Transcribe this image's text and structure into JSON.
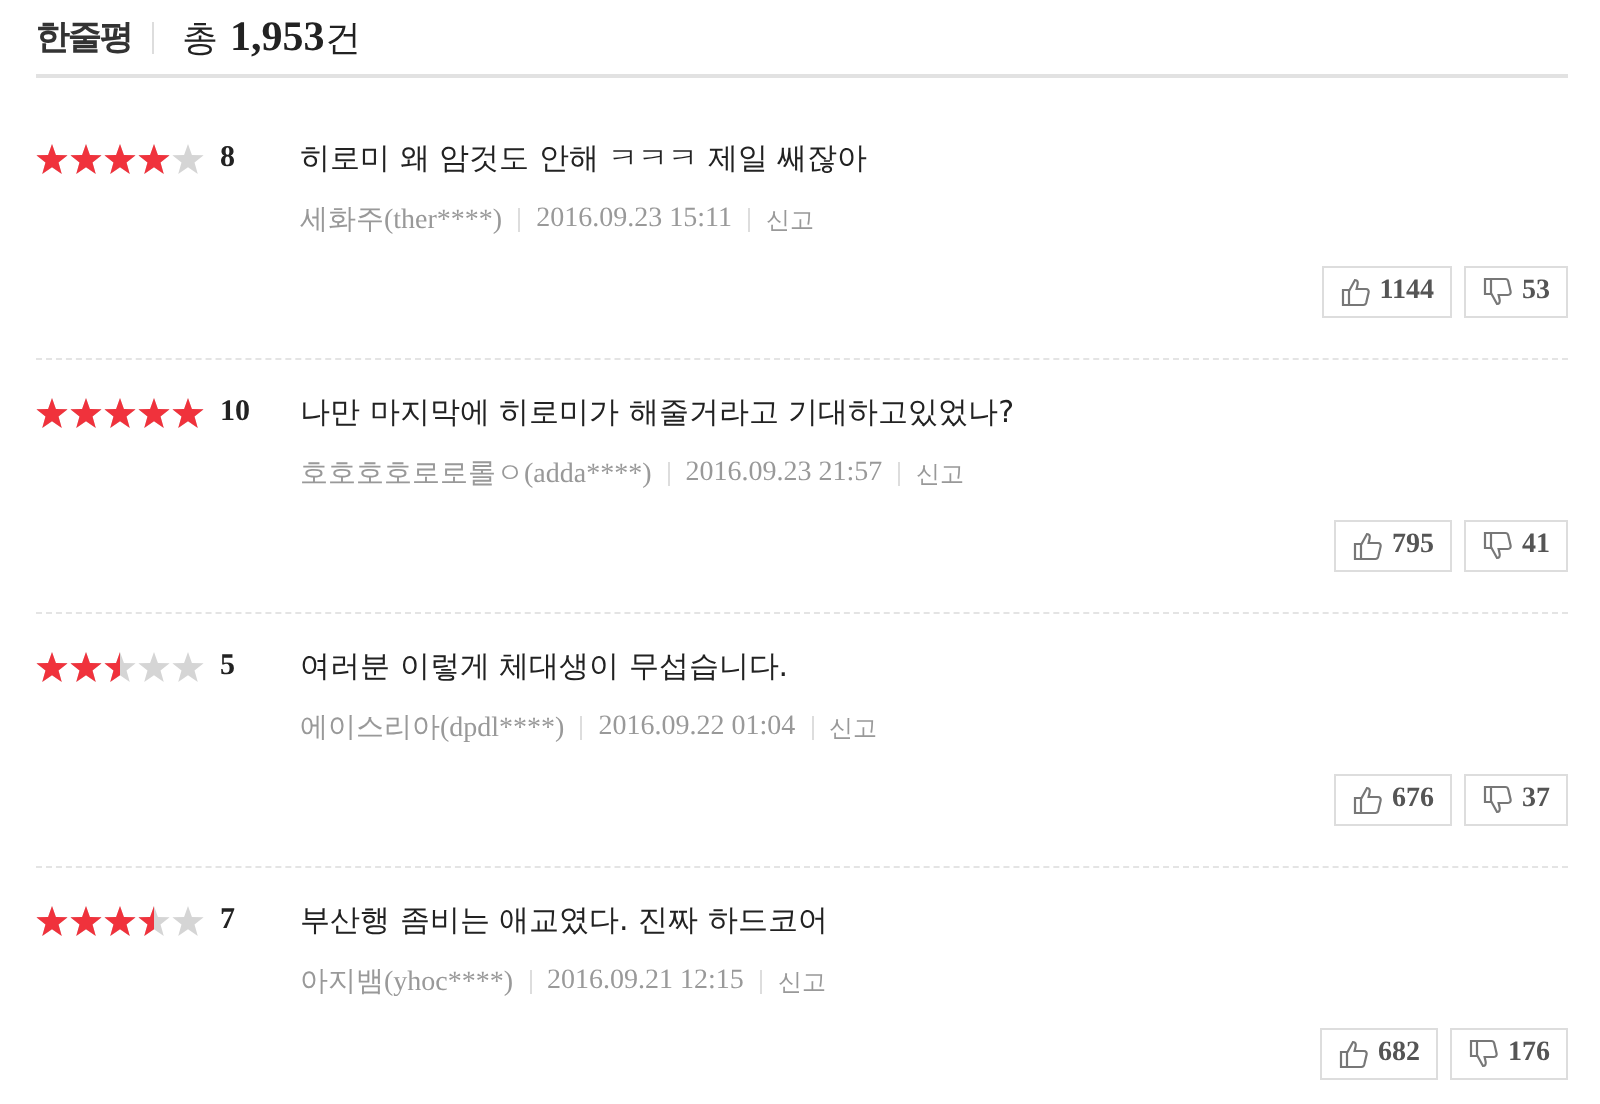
{
  "header": {
    "title": "한줄평",
    "total_prefix": "총",
    "total_count": "1,953",
    "total_suffix": "건"
  },
  "reviews": [
    {
      "stars": 4,
      "score": "8",
      "text": "히로미 왜 암것도 안해 ㅋㅋㅋ 제일 쌔잖아",
      "author": "세화주(ther****)",
      "date": "2016.09.23 15:11",
      "report": "신고",
      "likes": "1144",
      "dislikes": "53"
    },
    {
      "stars": 5,
      "score": "10",
      "text": "나만 마지막에 히로미가 해줄거라고 기대하고있었나?",
      "author": "호호호호로로롤ㅇ(adda****)",
      "date": "2016.09.23 21:57",
      "report": "신고",
      "likes": "795",
      "dislikes": "41"
    },
    {
      "stars": 2.5,
      "score": "5",
      "text": "여러분 이렇게 체대생이 무섭습니다.",
      "author": "에이스리아(dpdl****)",
      "date": "2016.09.22 01:04",
      "report": "신고",
      "likes": "676",
      "dislikes": "37"
    },
    {
      "stars": 3.5,
      "score": "7",
      "text": "부산행 좀비는 애교였다. 진짜 하드코어",
      "author": "아지뱀(yhoc****)",
      "date": "2016.09.21 12:15",
      "report": "신고",
      "likes": "682",
      "dislikes": "176"
    }
  ]
}
